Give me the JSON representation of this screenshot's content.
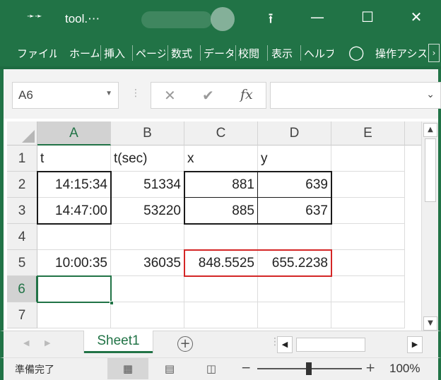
{
  "titlebar": {
    "quick_access_icon": "chevron-double-right",
    "title": "tool.⋯",
    "controls": {
      "ribbon_display": "⭱",
      "minimize": "—",
      "restore": "☐",
      "close": "✕"
    }
  },
  "ribbon": {
    "tabs": [
      "ファイル",
      "ホーム",
      "挿入",
      "ページ",
      "数式",
      "データ",
      "校閲",
      "表示",
      "ヘルプ"
    ],
    "tell_me_icon": "lightbulb",
    "tell_me": "操作アシス"
  },
  "formula_bar": {
    "name_box": "A6",
    "cancel": "✕",
    "enter": "✔",
    "fx": "fx",
    "formula": ""
  },
  "columns": [
    "A",
    "B",
    "C",
    "D",
    "E"
  ],
  "selected_column": "A",
  "rows": [
    {
      "num": "1",
      "cells": [
        "t",
        "t(sec)",
        "x",
        "y",
        ""
      ]
    },
    {
      "num": "2",
      "cells": [
        "14:15:34",
        "51334",
        "881",
        "639",
        ""
      ]
    },
    {
      "num": "3",
      "cells": [
        "14:47:00",
        "53220",
        "885",
        "637",
        ""
      ]
    },
    {
      "num": "4",
      "cells": [
        "",
        "",
        "",
        "",
        ""
      ]
    },
    {
      "num": "5",
      "cells": [
        "10:00:35",
        "36035",
        "848.5525",
        "655.2238",
        ""
      ]
    },
    {
      "num": "6",
      "cells": [
        "",
        "",
        "",
        "",
        ""
      ]
    },
    {
      "num": "7",
      "cells": [
        "",
        "",
        "",
        "",
        ""
      ]
    }
  ],
  "selected_row": "6",
  "active_cell": "A6",
  "sheets": [
    "Sheet1"
  ],
  "active_sheet": "Sheet1",
  "status": {
    "ready": "準備完了",
    "zoom_out": "−",
    "zoom_in": "+",
    "zoom": "100%"
  },
  "colors": {
    "excel_green": "#217346",
    "red_border": "#d42626"
  }
}
